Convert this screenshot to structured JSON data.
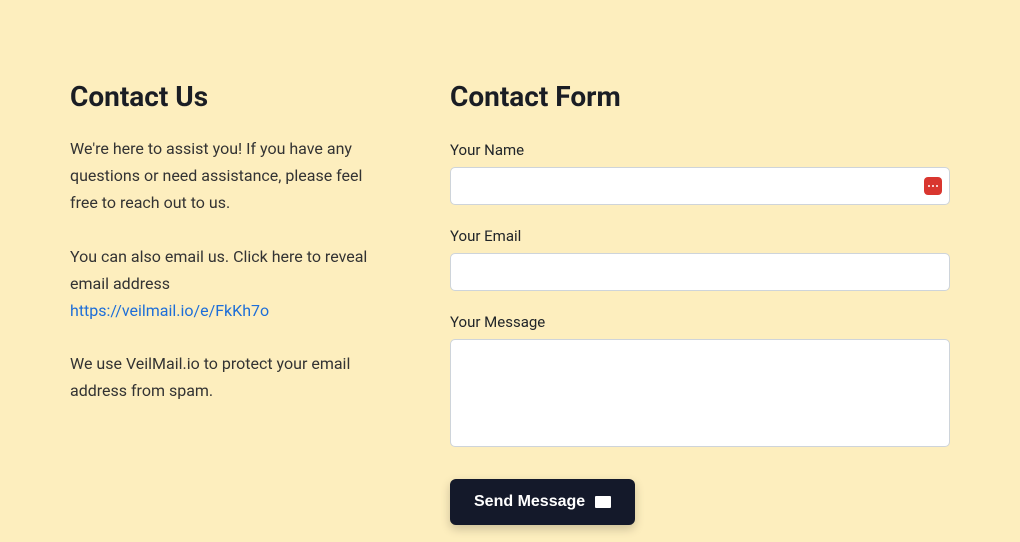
{
  "left": {
    "title": "Contact Us",
    "intro": "We're here to assist you! If you have any questions or need assistance, please feel free to reach out to us.",
    "email_intro": "You can also email us. Click here to reveal email address",
    "email_link": "https://veilmail.io/e/FkKh7o",
    "protect": "We use VeilMail.io to protect your email address from spam."
  },
  "form": {
    "title": "Contact Form",
    "name_label": "Your Name",
    "name_value": "",
    "email_label": "Your Email",
    "email_value": "",
    "message_label": "Your Message",
    "message_value": "",
    "send_label": "Send Message",
    "addon_icon": "password-manager-icon"
  }
}
